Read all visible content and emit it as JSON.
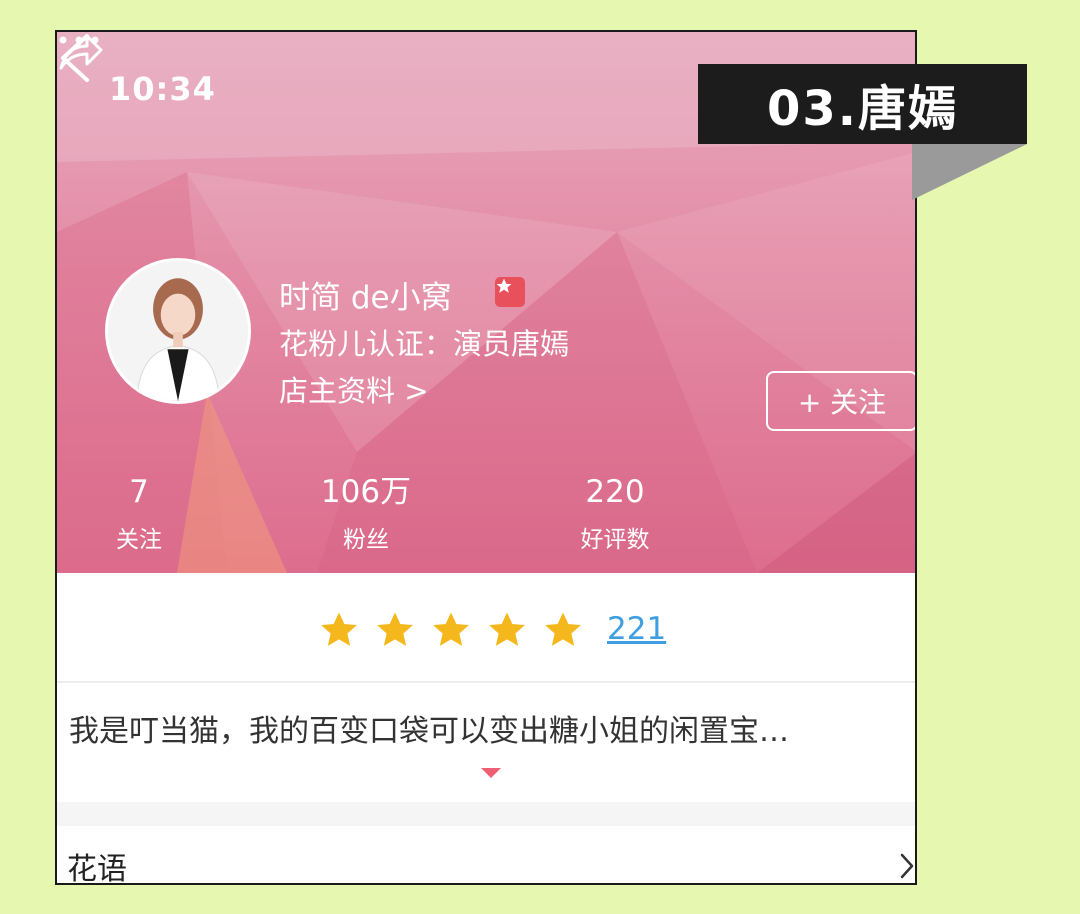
{
  "status_bar": {
    "time": "10:34"
  },
  "overlay_tag": {
    "text": "03.唐嫣"
  },
  "profile": {
    "shop_name": "时简 de小窝",
    "certification": "花粉儿认证：演员唐嫣",
    "owner_info_link": "店主资料 >",
    "follow_button": "+ 关注"
  },
  "stats": [
    {
      "value": "7",
      "label": "关注"
    },
    {
      "value": "106万",
      "label": "粉丝"
    },
    {
      "value": "220",
      "label": "好评数"
    }
  ],
  "rating": {
    "stars": 5,
    "stars_max": 5,
    "count": "221",
    "star_color": "#f5b81c"
  },
  "bio": {
    "text": "我是叮当猫，我的百变口袋可以变出糖小姐的闲置宝…"
  },
  "sections": {
    "flower_language": "花语"
  },
  "colors": {
    "background": "#e6f7b0",
    "header": "#e38aa5",
    "link": "#3d9ee0",
    "accent": "#ee5f75"
  },
  "icons": {
    "back": "chevron-left-icon",
    "share": "share-icon",
    "more": "more-icon",
    "badge": "star-badge-icon",
    "section": "chevron-right-icon"
  }
}
